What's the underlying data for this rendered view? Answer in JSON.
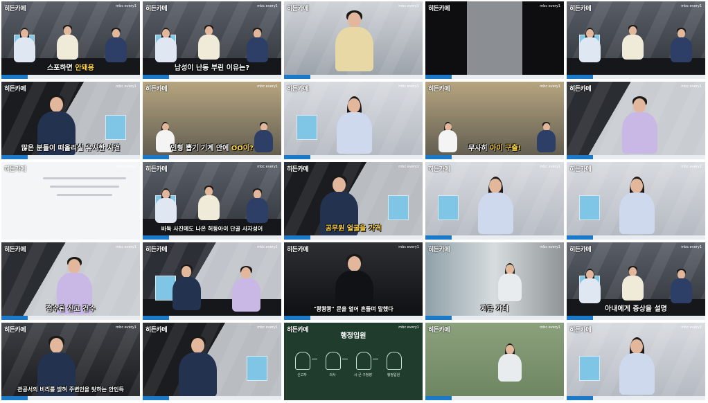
{
  "logo": "히든카메",
  "channel": "mbc every1",
  "frames": [
    {
      "id": "f01",
      "subtitle": "스포하면 ",
      "highlight": "안돼용",
      "variant": "studio-wide"
    },
    {
      "id": "f02",
      "subtitle": "남성이 난동 부린 이유는?",
      "highlight": "",
      "variant": "studio-wide"
    },
    {
      "id": "f03",
      "subtitle": "",
      "highlight": "",
      "variant": "host-center"
    },
    {
      "id": "f04",
      "subtitle": "",
      "highlight": "",
      "variant": "dark-blur"
    },
    {
      "id": "f05",
      "subtitle": "",
      "highlight": "",
      "variant": "studio-wide"
    },
    {
      "id": "f06",
      "subtitle": "많은 분들이 떠올리실 유사한 사건",
      "highlight": "",
      "variant": "host-left"
    },
    {
      "id": "f07",
      "subtitle": "인형 뽑기 기계 안에 ",
      "highlight": "OO이?",
      "variant": "claw-machine"
    },
    {
      "id": "f08",
      "subtitle": "",
      "highlight": "",
      "variant": "woman-center"
    },
    {
      "id": "f09",
      "subtitle": "무사히 ",
      "highlight": "아이 구출!",
      "variant": "claw-machine"
    },
    {
      "id": "f10",
      "subtitle": "",
      "highlight": "",
      "variant": "man-center"
    },
    {
      "id": "f11",
      "subtitle": "",
      "highlight": "",
      "variant": "phone-screen"
    },
    {
      "id": "f12",
      "subtitle": "바둑 사진에도 나온 허둥아이 단골 사자성어",
      "highlight": "",
      "variant": "studio-wide"
    },
    {
      "id": "f13",
      "subtitle": "",
      "highlight": "공무원 얼굴을 가격",
      "variant": "host-left"
    },
    {
      "id": "f14",
      "subtitle": "",
      "highlight": "",
      "variant": "woman-center"
    },
    {
      "id": "f15",
      "subtitle": "",
      "highlight": "",
      "variant": "woman-center"
    },
    {
      "id": "f16",
      "subtitle": "접수된 신고 건수",
      "highlight": "",
      "variant": "man-center"
    },
    {
      "id": "f17",
      "subtitle": "",
      "highlight": "",
      "variant": "desk-two"
    },
    {
      "id": "f18",
      "subtitle": "\"쾅쾅쾅\" 문을 열어 흔들며 말했다",
      "highlight": "",
      "variant": "dark-reenact"
    },
    {
      "id": "f19",
      "subtitle": "지금 가네",
      "highlight": "",
      "variant": "corridor"
    },
    {
      "id": "f20",
      "subtitle": "아내에게 증상을 설명",
      "highlight": "",
      "variant": "studio-wide"
    },
    {
      "id": "f21",
      "subtitle": "관공서의 비리를 밝혀 주변인을 탓하는 안인득",
      "highlight": "",
      "variant": "man-closeup"
    },
    {
      "id": "f22",
      "subtitle": "",
      "highlight": "",
      "variant": "host-left"
    },
    {
      "id": "f23",
      "subtitle": "",
      "highlight": "",
      "variant": "board",
      "board_title": "행정입원",
      "steps": [
        "신고자",
        "의사",
        "시·군·구청장",
        "행정입원"
      ]
    },
    {
      "id": "f24",
      "subtitle": "",
      "highlight": "",
      "variant": "outdoor"
    },
    {
      "id": "f25",
      "subtitle": "",
      "highlight": "",
      "variant": "woman-center"
    }
  ]
}
